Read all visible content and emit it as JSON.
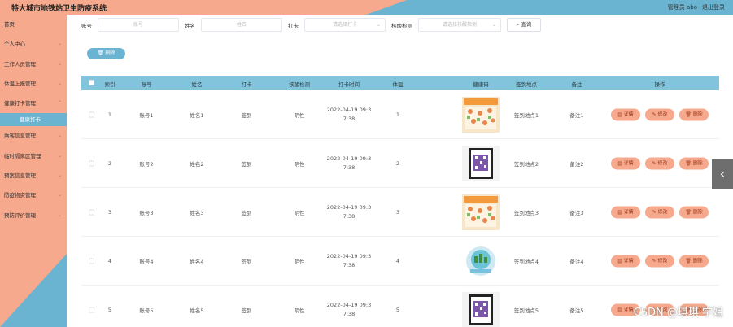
{
  "header": {
    "title": "特大城市地铁站卫生防疫系统",
    "user": "管理员 abo",
    "logout": "退出登录"
  },
  "sidebar": {
    "items": [
      {
        "label": "首页",
        "chev": ""
      },
      {
        "label": "个人中心",
        "chev": "⌄"
      },
      {
        "label": "工作人员管理",
        "chev": "⌄"
      },
      {
        "label": "体温上报管理",
        "chev": "⌄"
      },
      {
        "label": "健康打卡管理",
        "chev": "⌃"
      },
      {
        "label": "健康打卡",
        "sub": true
      },
      {
        "label": "乘客信息管理",
        "chev": "⌄"
      },
      {
        "label": "临时隔离区管理",
        "chev": "⌄"
      },
      {
        "label": "预案信息管理",
        "chev": "⌄"
      },
      {
        "label": "防疫物资管理",
        "chev": "⌄"
      },
      {
        "label": "预防评价管理",
        "chev": "⌄"
      }
    ]
  },
  "search": {
    "account_label": "账号",
    "account_placeholder": "账号",
    "name_label": "姓名",
    "name_placeholder": "姓名",
    "checkin_label": "打卡",
    "checkin_placeholder": "请选择打卡",
    "nucleic_label": "核酸检测",
    "nucleic_placeholder": "请选择核酸检测",
    "search_button": "查询",
    "search_icon": "search-icon"
  },
  "toolbar": {
    "delete_label": "删除",
    "delete_icon": "trash-icon"
  },
  "table": {
    "headers": [
      "索引",
      "账号",
      "姓名",
      "打卡",
      "核酸检测",
      "打卡时间",
      "体温",
      "健康码",
      "签到地点",
      "备注",
      "操作"
    ],
    "rows": [
      {
        "index": "1",
        "account": "账号1",
        "name": "姓名1",
        "checkin": "签到",
        "nucleic": "阴性",
        "time1": "2022-04-19 09:3",
        "time2": "7:38",
        "temp": "1",
        "qr": "poster",
        "place": "签到地点1",
        "note": "备注1"
      },
      {
        "index": "2",
        "account": "账号2",
        "name": "姓名2",
        "checkin": "签到",
        "nucleic": "阴性",
        "time1": "2022-04-19 09:3",
        "time2": "7:38",
        "temp": "2",
        "qr": "frame",
        "place": "签到地点2",
        "note": "备注2"
      },
      {
        "index": "3",
        "account": "账号3",
        "name": "姓名3",
        "checkin": "签到",
        "nucleic": "阴性",
        "time1": "2022-04-19 09:3",
        "time2": "7:38",
        "temp": "3",
        "qr": "poster",
        "place": "签到地点3",
        "note": "备注3"
      },
      {
        "index": "4",
        "account": "账号4",
        "name": "姓名4",
        "checkin": "签到",
        "nucleic": "阴性",
        "time1": "2022-04-19 09:3",
        "time2": "7:38",
        "temp": "4",
        "qr": "globe",
        "place": "签到地点4",
        "note": "备注4"
      },
      {
        "index": "5",
        "account": "账号5",
        "name": "姓名5",
        "checkin": "签到",
        "nucleic": "阴性",
        "time1": "2022-04-19 09:3",
        "time2": "7:38",
        "temp": "5",
        "qr": "frame",
        "place": "签到地点5",
        "note": "备注5"
      }
    ],
    "actions": {
      "detail": "详情",
      "edit": "修改",
      "delete": "删除"
    }
  },
  "float_button": "‹",
  "watermark": "CSDN @琪琪 学姐",
  "colors": {
    "salmon": "#f6a98c",
    "blue": "#6ab4d2",
    "header_blue": "#83c4dd"
  }
}
